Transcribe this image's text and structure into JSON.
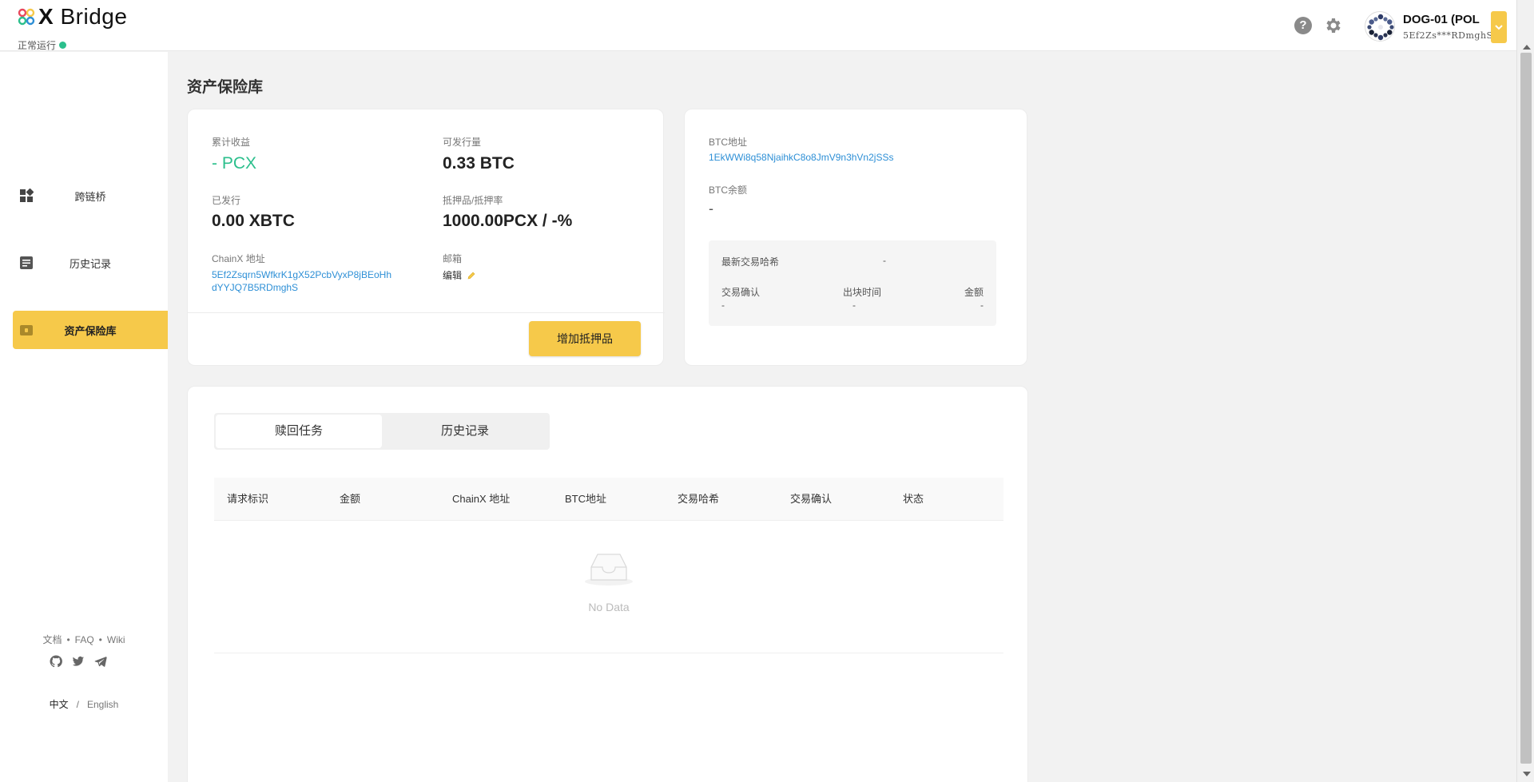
{
  "app": {
    "logo_x": "X",
    "logo_name": "Bridge",
    "status": "正常运行"
  },
  "header": {
    "help_icon": "?",
    "account_name": "DOG-01 (POL",
    "account_addr": "5Ef2Zs***RDmghS"
  },
  "sidebar": {
    "items": [
      {
        "label": "跨链桥",
        "icon": "dashboard-icon"
      },
      {
        "label": "历史记录",
        "icon": "document-icon"
      },
      {
        "label": "资产保险库",
        "icon": "vault-icon"
      }
    ],
    "footer": {
      "docs": "文档",
      "faq": "FAQ",
      "wiki": "Wiki",
      "sep": "•"
    },
    "lang": {
      "zh": "中文",
      "sep": "/",
      "en": "English"
    }
  },
  "page": {
    "title": "资产保险库"
  },
  "vault": {
    "earnings_label": "累计收益",
    "earnings_value": "- PCX",
    "issuable_label": "可发行量",
    "issuable_value": "0.33 BTC",
    "issued_label": "已发行",
    "issued_value": "0.00 XBTC",
    "collateral_label": "抵押品/抵押率",
    "collateral_value": "1000.00PCX / -%",
    "chainx_label": "ChainX 地址",
    "chainx_addr_line1": "5Ef2Zsqrn5WfkrK1gX52PcbVyxP8jBEoHh",
    "chainx_addr_line2": "dYYJQ7B5RDmghS",
    "email_label": "邮箱",
    "email_edit": "编辑",
    "add_button": "增加抵押品"
  },
  "btc": {
    "addr_label": "BTC地址",
    "addr_value": "1EkWWi8q58NjaihkC8o8JmV9n3hVn2jSSs",
    "balance_label": "BTC余额",
    "balance_value": "-",
    "latest_hash_label": "最新交易哈希",
    "latest_hash_value": "-",
    "confirm_label": "交易确认",
    "confirm_value": "-",
    "block_time_label": "出块时间",
    "block_time_value": "-",
    "amount_label": "金额",
    "amount_value": "-"
  },
  "tasks": {
    "tabs": [
      {
        "label": "赎回任务"
      },
      {
        "label": "历史记录"
      }
    ],
    "columns": [
      "请求标识",
      "金额",
      "ChainX 地址",
      "BTC地址",
      "交易哈希",
      "交易确认",
      "状态"
    ],
    "empty_text": "No Data"
  },
  "colors": {
    "accent": "#f6c94a",
    "green": "#2bbf8c",
    "link": "#2d8fd6"
  }
}
